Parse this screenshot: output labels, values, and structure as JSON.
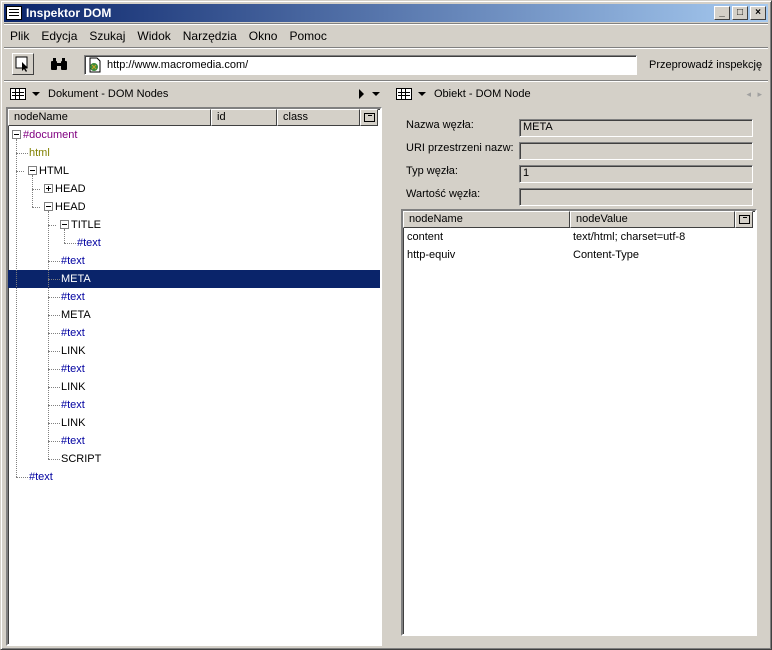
{
  "window": {
    "title": "Inspektor DOM",
    "min": "_",
    "max": "□",
    "close": "×"
  },
  "menu": [
    {
      "label": "Plik"
    },
    {
      "label": "Edycja"
    },
    {
      "label": "Szukaj"
    },
    {
      "label": "Widok"
    },
    {
      "label": "Narzędzia"
    },
    {
      "label": "Okno"
    },
    {
      "label": "Pomoc"
    }
  ],
  "toolbar": {
    "url": "http://www.macromedia.com/",
    "inspect_label": "Przeprowadź inspekcję"
  },
  "left_pane": {
    "title": "Dokument - DOM Nodes",
    "columns": [
      "nodeName",
      "id",
      "class"
    ],
    "tree": [
      {
        "label": "#document",
        "kind": "doc",
        "expanded": true
      },
      {
        "label": "html",
        "kind": "dtd"
      },
      {
        "label": "HTML",
        "kind": "el",
        "expanded": true
      },
      {
        "label": "HEAD",
        "kind": "el",
        "expanded": false
      },
      {
        "label": "HEAD",
        "kind": "el",
        "expanded": true
      },
      {
        "label": "TITLE",
        "kind": "el",
        "expanded": true
      },
      {
        "label": "#text",
        "kind": "txt"
      },
      {
        "label": "#text",
        "kind": "txt"
      },
      {
        "label": "META",
        "kind": "el",
        "selected": true
      },
      {
        "label": "#text",
        "kind": "txt"
      },
      {
        "label": "META",
        "kind": "el"
      },
      {
        "label": "#text",
        "kind": "txt"
      },
      {
        "label": "LINK",
        "kind": "el"
      },
      {
        "label": "#text",
        "kind": "txt"
      },
      {
        "label": "LINK",
        "kind": "el"
      },
      {
        "label": "#text",
        "kind": "txt"
      },
      {
        "label": "LINK",
        "kind": "el"
      },
      {
        "label": "#text",
        "kind": "txt"
      },
      {
        "label": "SCRIPT",
        "kind": "el"
      },
      {
        "label": "#text",
        "kind": "txt"
      }
    ]
  },
  "right_pane": {
    "title": "Obiekt - DOM Node",
    "fields": [
      {
        "label": "Nazwa węzła:",
        "value": "META"
      },
      {
        "label": "URI przestrzeni nazw:",
        "value": ""
      },
      {
        "label": "Typ węzła:",
        "value": "1"
      },
      {
        "label": "Wartość węzła:",
        "value": ""
      }
    ],
    "columns": [
      "nodeName",
      "nodeValue"
    ],
    "attributes": [
      {
        "name": "content",
        "value": "text/html; charset=utf-8"
      },
      {
        "name": "http-equiv",
        "value": "Content-Type"
      }
    ]
  }
}
